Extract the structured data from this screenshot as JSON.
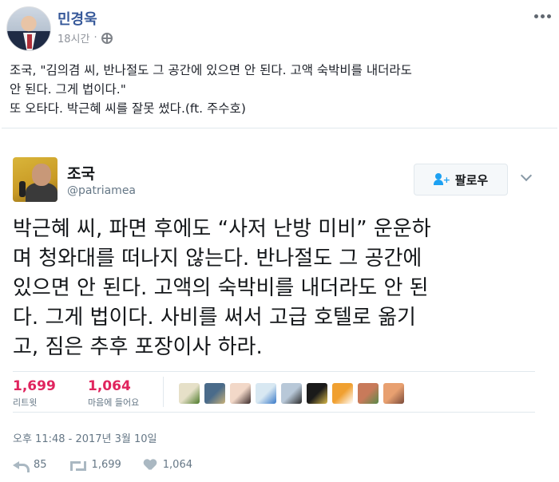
{
  "post": {
    "author": "민경욱",
    "time": "18시간",
    "lines": [
      "조국, \"김의겸 씨, 반나절도 그 공간에 있으면 안 된다. 고액 숙박비를 내더라도",
      "안 된다. 그게 법이다.\"",
      "또 오타다. 박근혜 씨를 잘못 썼다.(ft. 주수호)"
    ]
  },
  "tweet": {
    "name": "조국",
    "handle": "@patriamea",
    "follow_label": "팔로우",
    "lines": [
      "박근혜 씨, 파면 후에도 “사저 난방 미비” 운운하",
      "며 청와대를 떠나지 않는다. 반나절도 그 공간에",
      "있으면 안 된다. 고액의 숙박비를 내더라도 안 된",
      "다. 그게 법이다. 사비를 써서 고급 호텔로 옮기",
      "고, 짐은 추후 포장이사 하라."
    ],
    "retweets_count": "1,699",
    "retweets_label": "리트윗",
    "likes_count": "1,064",
    "likes_label": "마음에 들어요",
    "timestamp": "오후 11:48 - 2017년 3월 10일",
    "action_reply_count": "85",
    "action_retweet_count": "1,699",
    "action_like_count": "1,064"
  },
  "colors": {
    "fb_link": "#365899",
    "twitter_red": "#e0245e",
    "twitter_blue": "#1da1f2"
  },
  "likers": [
    {
      "color1": "#e6e0c8",
      "color2": "#4d7a2a"
    },
    {
      "color1": "#4a6b8a",
      "color2": "#c9b27a"
    },
    {
      "color1": "#f2d8c8",
      "color2": "#3a2a2a"
    },
    {
      "color1": "#d8e8f2",
      "color2": "#3a7ac8"
    },
    {
      "color1": "#b8c8d8",
      "color2": "#2a2a2a"
    },
    {
      "color1": "#1a1a1a",
      "color2": "#d8b84a"
    },
    {
      "color1": "#f0a030",
      "color2": "#ffffff"
    },
    {
      "color1": "#c87a5a",
      "color2": "#5a8a4a"
    },
    {
      "color1": "#e8a070",
      "color2": "#7a4a3a"
    }
  ]
}
